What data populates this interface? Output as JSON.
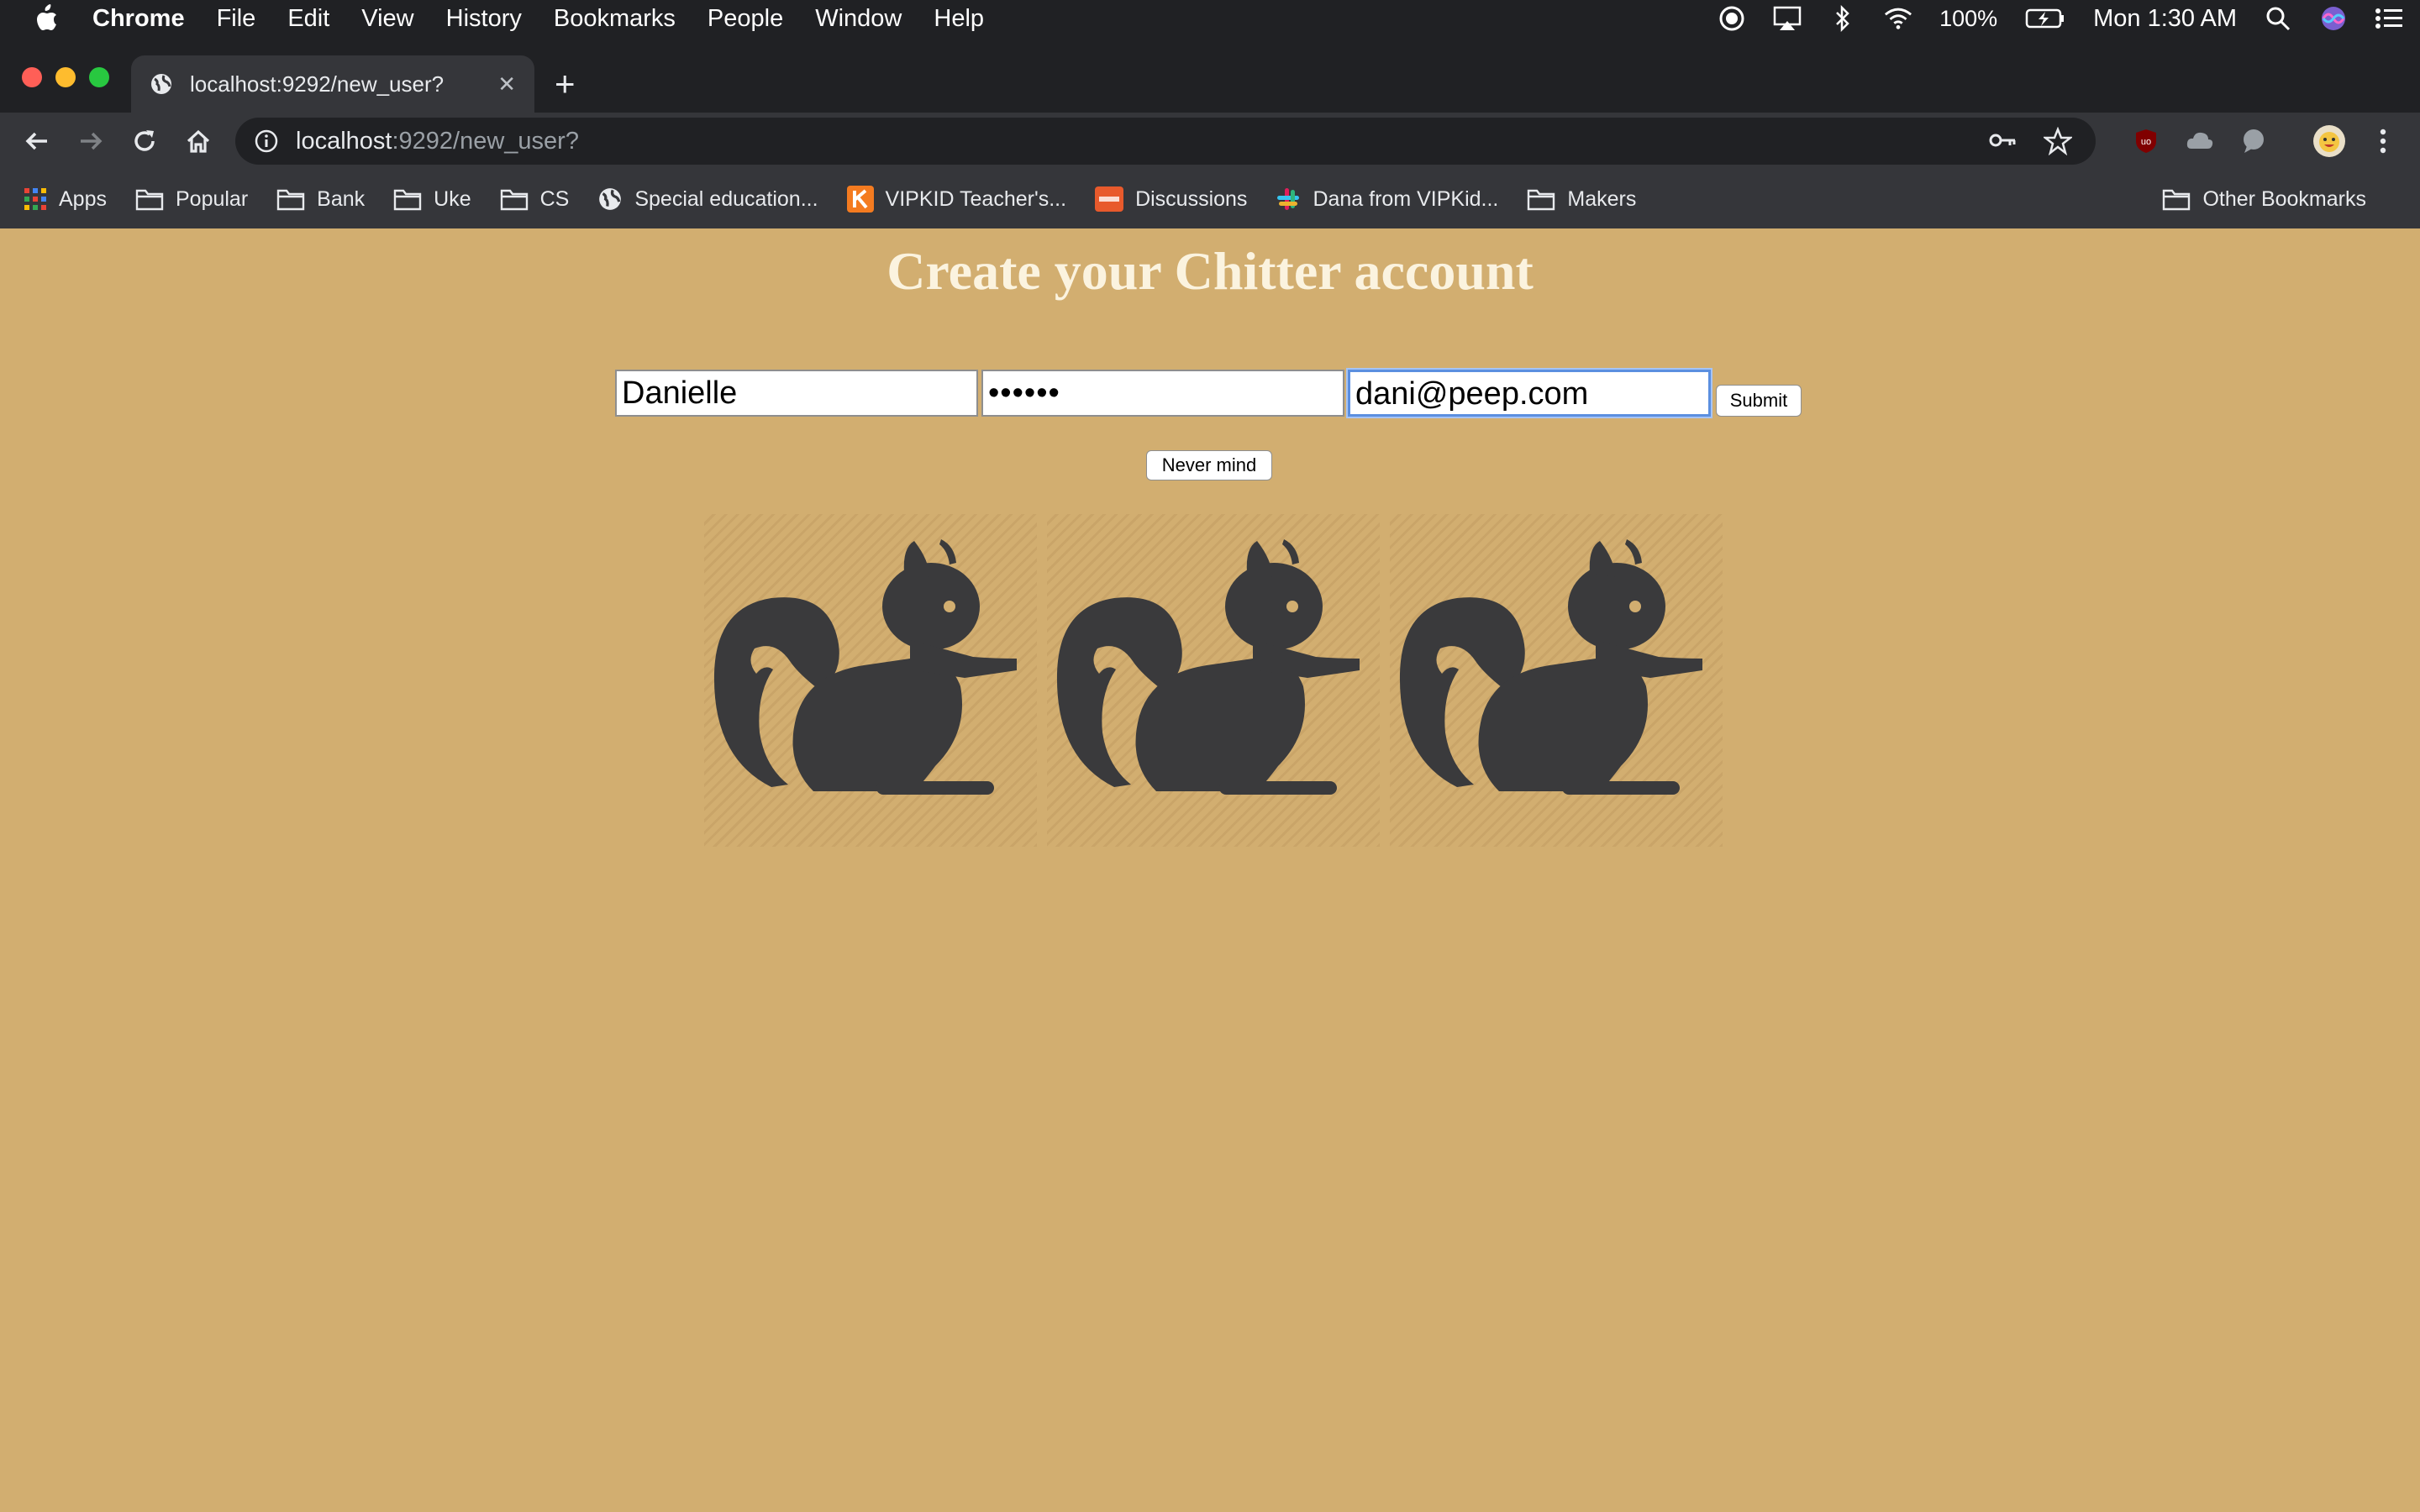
{
  "menubar": {
    "app": "Chrome",
    "items": [
      "File",
      "Edit",
      "View",
      "History",
      "Bookmarks",
      "People",
      "Window",
      "Help"
    ],
    "battery": "100%",
    "clock": "Mon 1:30 AM"
  },
  "tab": {
    "title": "localhost:9292/new_user?",
    "close": "✕",
    "new_tab": "+"
  },
  "address": {
    "host": "localhost",
    "path": ":9292/new_user?"
  },
  "bookmarks": [
    {
      "label": "Apps",
      "icon": "apps-grid-icon"
    },
    {
      "label": "Popular",
      "icon": "folder-icon"
    },
    {
      "label": "Bank",
      "icon": "folder-icon"
    },
    {
      "label": "Uke",
      "icon": "folder-icon"
    },
    {
      "label": "CS",
      "icon": "folder-icon"
    },
    {
      "label": "Special education...",
      "icon": "globe-icon"
    },
    {
      "label": "VIPKID Teacher's...",
      "icon": "vipkid-icon"
    },
    {
      "label": "Discussions",
      "icon": "discussions-icon"
    },
    {
      "label": "Dana from VIPKid...",
      "icon": "slack-icon"
    },
    {
      "label": "Makers",
      "icon": "folder-icon"
    }
  ],
  "other_bookmarks": "Other Bookmarks",
  "page": {
    "heading": "Create your Chitter account",
    "name_value": "Danielle",
    "password_value": "••••••",
    "email_value": "dani@peep.com",
    "submit_label": "Submit",
    "never_mind_label": "Never mind",
    "image_icon": "squirrel-icon",
    "image_count": 3
  },
  "colors": {
    "page_background": "#d2ae70",
    "heading": "#fbf3df",
    "squirrel": "#3a3a3c",
    "chrome_dark": "#202124",
    "chrome_toolbar": "#35363a",
    "focus_ring": "#5b8fe0"
  }
}
